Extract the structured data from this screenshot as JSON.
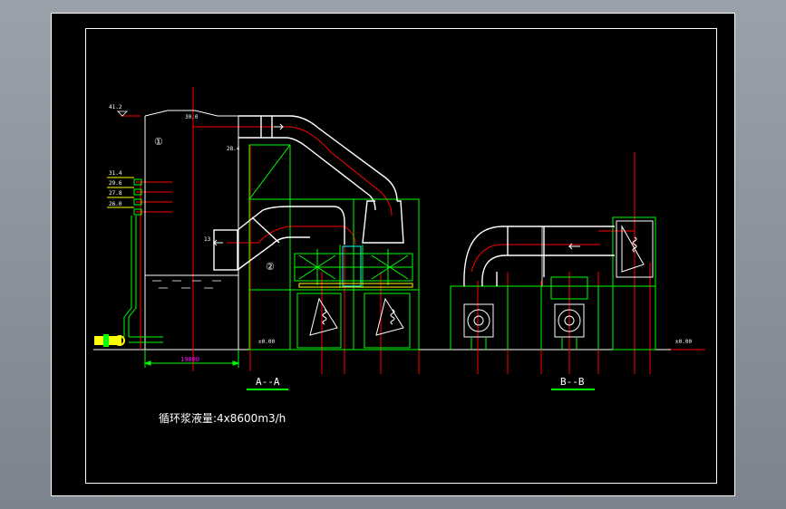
{
  "drawing": {
    "section_a_label": "A--A",
    "section_b_label": "B--B",
    "note": "循环浆液量:4x8600m3/h",
    "elev_top": "41.2",
    "elev_outlet": "30.0",
    "elev_duct": "28.4",
    "elev_levels": [
      "31.4",
      "29.6",
      "27.8",
      "26.0"
    ],
    "elev_ground_a": "±0.00",
    "elev_ground_b": "±0.00",
    "inlet_elev": "13",
    "dimension_width": "19800",
    "tag_tower": "①",
    "tag_unit": "②"
  },
  "colors": {
    "background": "#000000",
    "structure": "#00ff00",
    "outline": "#ffffff",
    "centerline": "#ff0000",
    "dimension": "#ff00ff",
    "highlight": "#ffff00",
    "cyan": "#00ffff"
  }
}
